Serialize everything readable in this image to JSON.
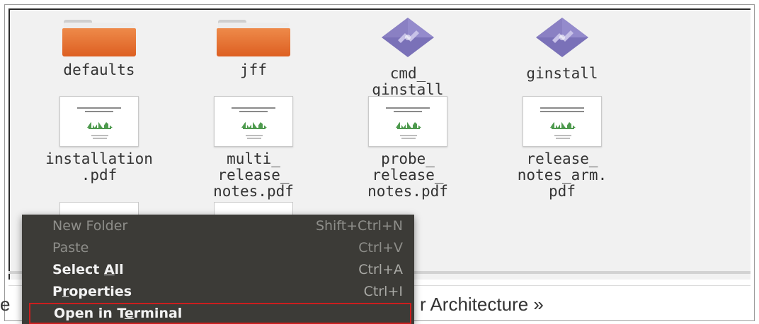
{
  "files": [
    {
      "label": "defaults",
      "type": "folder",
      "icon": "folder-icon"
    },
    {
      "label": "jff",
      "type": "folder",
      "icon": "folder-icon"
    },
    {
      "label": "cmd_\nginstall",
      "type": "executable",
      "icon": "executable-icon"
    },
    {
      "label": "ginstall",
      "type": "executable",
      "icon": "executable-icon"
    },
    {
      "label": "installation\n.pdf",
      "type": "pdf",
      "icon": "pdf-icon"
    },
    {
      "label": "multi_\nrelease_\nnotes.pdf",
      "type": "pdf",
      "icon": "pdf-icon"
    },
    {
      "label": "probe_\nrelease_\nnotes.pdf",
      "type": "pdf",
      "icon": "pdf-icon"
    },
    {
      "label": "release_\nnotes_arm.\npdf",
      "type": "pdf",
      "icon": "pdf-icon"
    }
  ],
  "context_menu": {
    "items": [
      {
        "pre": "New Folder",
        "acc": "",
        "post": "",
        "shortcut": "Shift+Ctrl+N",
        "enabled": false
      },
      {
        "pre": "Paste",
        "acc": "",
        "post": "",
        "shortcut": "Ctrl+V",
        "enabled": false
      },
      {
        "pre": "Select ",
        "acc": "A",
        "post": "ll",
        "shortcut": "Ctrl+A",
        "enabled": true
      },
      {
        "pre": "P",
        "acc": "r",
        "post": "operties",
        "shortcut": "Ctrl+I",
        "enabled": true
      },
      {
        "pre": "Open in T",
        "acc": "e",
        "post": "rminal",
        "shortcut": "",
        "enabled": true,
        "highlighted": true
      }
    ]
  },
  "page": {
    "left_fragment": "e",
    "right_fragment": "r Architecture »"
  },
  "colors": {
    "folder": "#e26a2c",
    "menu_background": "#3c3b37",
    "highlight_border": "#cc1e1e",
    "pane_background": "#f1f1f1"
  }
}
